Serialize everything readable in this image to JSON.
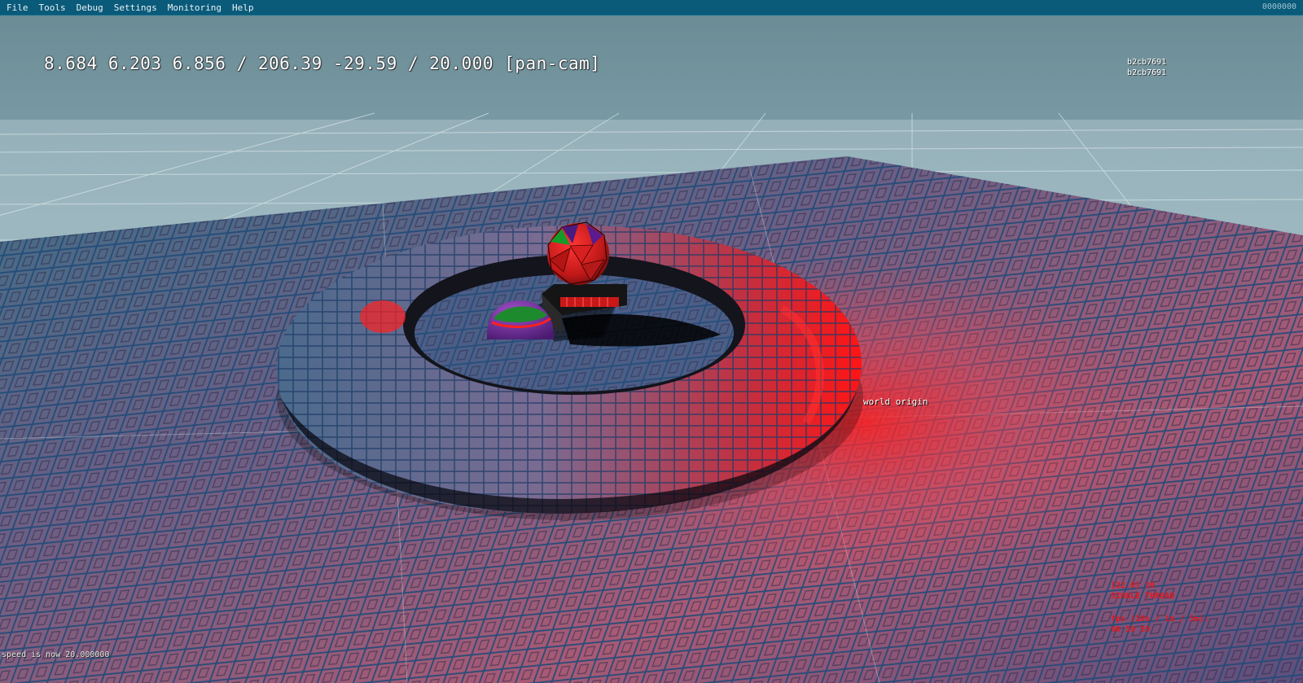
{
  "menu": {
    "items": [
      "File",
      "Tools",
      "Debug",
      "Settings",
      "Monitoring",
      "Help"
    ],
    "right_text": "0000000"
  },
  "hud": {
    "camera_readout": "8.684 6.203 6.856 / 206.39 -29.59 / 20.000 [pan-cam]",
    "build_hash_1": "b2cb7691",
    "build_hash_2": "b2cb7691",
    "origin_label": "world origin",
    "stats": {
      "line1": "[22.0] 20",
      "line2": "SINGLE THREAD",
      "line3": "fps (10s / 1m / 5m):",
      "line4": "60 59 59"
    },
    "speed_message": "speed is now 20.000000"
  },
  "colors": {
    "menubar": "#0a5a7a",
    "sky": "#6f8f99",
    "stats_text": "#e0181d",
    "red_light": "#ff1010"
  }
}
